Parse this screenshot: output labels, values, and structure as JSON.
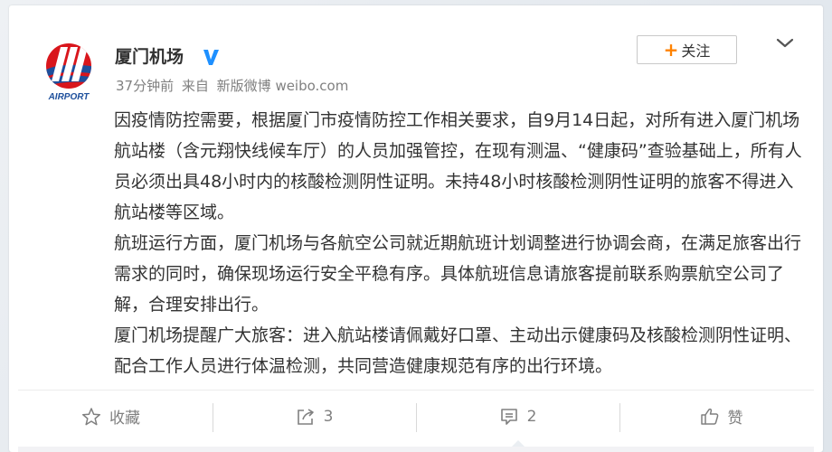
{
  "account": {
    "name": "厦门机场",
    "logo_text": "AIRPORT",
    "verified_icon": "verified-badge-icon",
    "verified_color": "#1e90ff"
  },
  "meta": {
    "time": "37分钟前",
    "source_prefix": "来自",
    "source": "新版微博 weibo.com"
  },
  "follow": {
    "label": "关注",
    "plus": "+",
    "accent": "#ff8200"
  },
  "content": {
    "paragraphs": [
      "因疫情防控需要，根据厦门市疫情防控工作相关要求，自9月14日起，对所有进入厦门机场航站楼（含元翔快线候车厅）的人员加强管控，在现有测温、“健康码”查验基础上，所有人员必须出具48小时内的核酸检测阴性证明。未持48小时核酸检测阴性证明的旅客不得进入航站楼等区域。",
      "航班运行方面，厦门机场与各航空公司就近期航班计划调整进行协调会商，在满足旅客出行需求的同时，确保现场运行安全平稳有序。具体航班信息请旅客提前联系购票航空公司了解，合理安排出行。",
      "厦门机场提醒广大旅客：进入航站楼请佩戴好口罩、主动出示健康码及核酸检测阴性证明、配合工作人员进行体温检测，共同营造健康规范有序的出行环境。"
    ]
  },
  "actions": {
    "favorite": {
      "label": "收藏",
      "icon": "star-icon"
    },
    "repost": {
      "count": "3",
      "icon": "share-icon"
    },
    "comment": {
      "count": "2",
      "icon": "comment-icon"
    },
    "like": {
      "label": "赞",
      "icon": "thumbs-up-icon"
    }
  }
}
